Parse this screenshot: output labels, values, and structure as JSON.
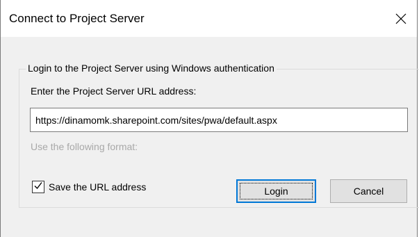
{
  "window": {
    "title": "Connect to Project Server",
    "close_icon": "close-icon"
  },
  "group": {
    "legend": "Login to the Project Server using Windows authentication",
    "url_label": "Enter the Project Server URL address:",
    "url_value": "https://dinamomk.sharepoint.com/sites/pwa/default.aspx",
    "format_hint": "Use the following format:"
  },
  "options": {
    "save_url_label": "Save the URL address",
    "save_url_checked": true
  },
  "buttons": {
    "login_label": "Login",
    "cancel_label": "Cancel"
  },
  "colors": {
    "focus_accent": "#0078d7",
    "hint_text": "#a8a8a8"
  }
}
